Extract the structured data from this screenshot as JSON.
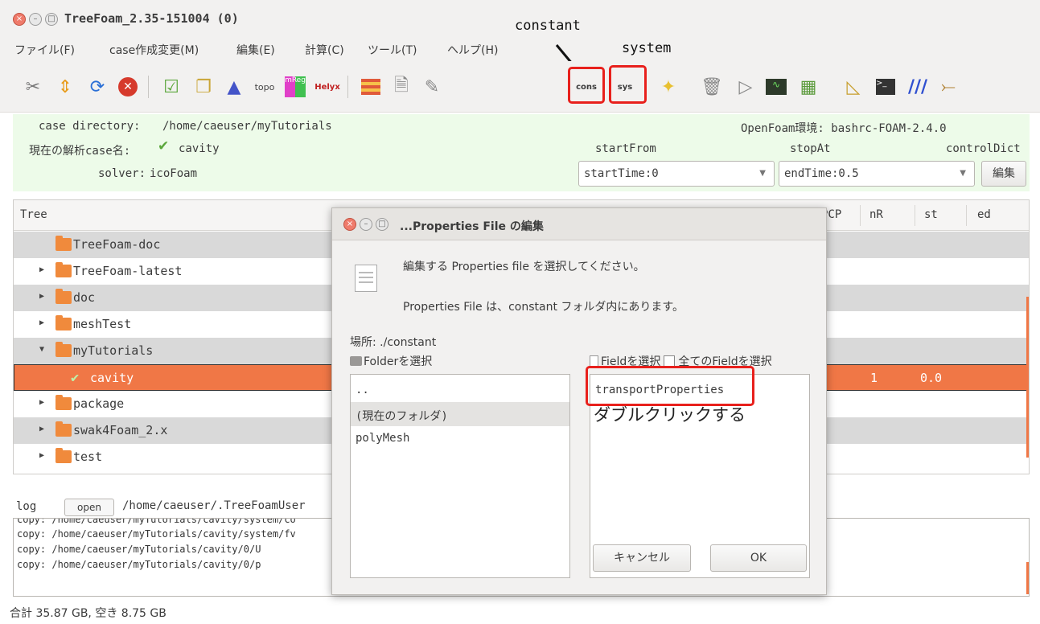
{
  "window": {
    "title": "TreeFoam_2.35-151004 (0)"
  },
  "menu": [
    "ファイル(F)",
    "case作成変更(M)",
    "編集(E)",
    "計算(C)",
    "ツール(T)",
    "ヘルプ(H)"
  ],
  "toolbar": {
    "icons": [
      "tools-icon",
      "move-icon",
      "refresh-icon",
      "stop-icon",
      "check-icon",
      "copy-icon",
      "mesh-icon",
      "topo-icon",
      "mreg-icon",
      "helyx-icon",
      "grid-icon",
      "file-icon",
      "edit-icon",
      "constant-icon",
      "system-icon",
      "new-icon",
      "trash-icon",
      "play-icon",
      "monitor-icon",
      "layout-icon",
      "paraview-icon",
      "terminal-icon",
      "chart-icon",
      "scope-icon"
    ],
    "cons_text": "cons",
    "sys_text": "sys",
    "topo_text": "topo",
    "mreg_text": "mReg",
    "helyx_text": "Helyx"
  },
  "annotations": {
    "constant": "constant",
    "system": "system",
    "double_click": "ダブルクリックする"
  },
  "info": {
    "case_directory_label": "case directory:",
    "case_directory_value": "/home/caeuser/myTutorials",
    "openfoam_env": "OpenFoam環境: bashrc-FOAM-2.4.0",
    "case_name_label": "現在の解析case名:",
    "case_name_value": "cavity",
    "solver_label": "solver:",
    "solver_value": "icoFoam",
    "start_from_label": "startFrom",
    "stop_at_label": "stopAt",
    "control_dict_label": "controlDict",
    "start_from_value": "startTime:0",
    "stop_at_value": "endTime:0.5",
    "edit_button": "編集"
  },
  "tree": {
    "headers": [
      "Tree",
      "nR",
      "st",
      "ed"
    ],
    "partial_header_a": "l",
    "partial_header_b": "PCP",
    "rows": [
      {
        "label": "TreeFoam-doc",
        "expander": ""
      },
      {
        "label": "TreeFoam-latest",
        "expander": "▶"
      },
      {
        "label": "doc",
        "expander": "▶"
      },
      {
        "label": "meshTest",
        "expander": "▶"
      },
      {
        "label": "myTutorials",
        "expander": "▼"
      },
      {
        "label": "cavity",
        "expander": "",
        "nR": "1",
        "st": "0.0"
      },
      {
        "label": "package",
        "expander": "▶"
      },
      {
        "label": "swak4Foam_2.x",
        "expander": "▶"
      },
      {
        "label": "test",
        "expander": "▶"
      }
    ]
  },
  "log": {
    "label": "log",
    "open_button": "open",
    "path": "/home/caeuser/.TreeFoamUser",
    "lines": [
      "copy: /home/caeuser/myTutorials/cavity/system/co",
      "copy: /home/caeuser/myTutorials/cavity/system/fv",
      "copy: /home/caeuser/myTutorials/cavity/0/U",
      "copy: /home/caeuser/myTutorials/cavity/0/p"
    ]
  },
  "status": "合計 35.87 GB,  空き 8.75 GB",
  "dialog": {
    "title": "...Properties File の編集",
    "message1": "編集する Properties file を選択してください。",
    "message2": "Properties File は、constant フォルダ内にあります。",
    "location": "場所: ./constant",
    "folder_label": "Folderを選択",
    "field_label": "Fieldを選択",
    "all_fields_label": "全てのFieldを選択",
    "folders": [
      "..",
      "(現在のフォルダ)",
      "polyMesh"
    ],
    "fields": [
      "transportProperties"
    ],
    "cancel_button": "キャンセル",
    "ok_button": "OK"
  },
  "colors": {
    "accent": "#f07746",
    "highlight_box": "#e8201c",
    "info_bg": "#edfbe9"
  }
}
